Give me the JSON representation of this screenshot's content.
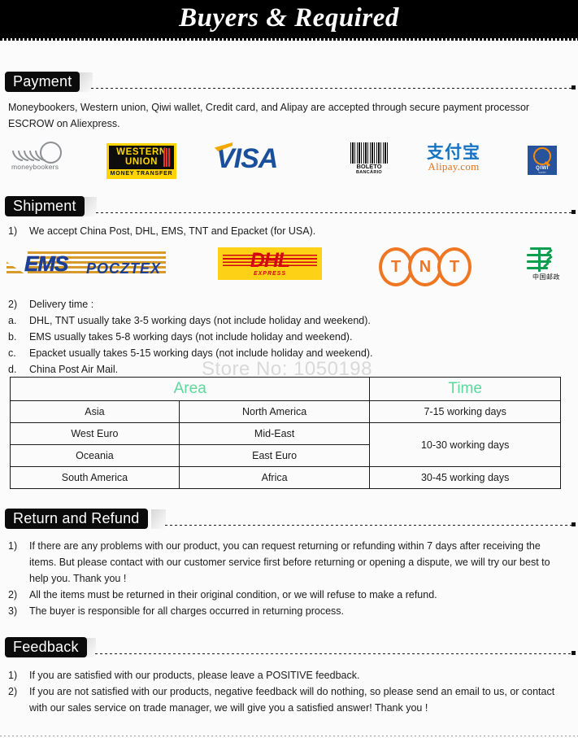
{
  "banner": {
    "title": "Buyers & Required"
  },
  "watermark": "Store No: 1050198",
  "sections": {
    "payment": {
      "tab": "Payment",
      "paragraph": "Moneybookers, Western union, Qiwi wallet, Credit card, and Alipay are accepted through secure payment processor ESCROW on Aliexpress.",
      "logos": [
        {
          "name": "moneybookers-logo",
          "label": "moneybookers"
        },
        {
          "name": "western-union-logo",
          "line1": "WESTERN",
          "line2": "UNION",
          "sub": "MONEY TRANSFER"
        },
        {
          "name": "visa-logo",
          "label": "VISA"
        },
        {
          "name": "boleto-bancario-logo",
          "line1": "BOLETO",
          "line2": "BANCÁRIO"
        },
        {
          "name": "alipay-logo",
          "cn": "支付宝",
          "en": "Alipay.com"
        },
        {
          "name": "qiwi-logo",
          "label": "QIWI",
          "sub": "wallet"
        }
      ]
    },
    "shipment": {
      "tab": "Shipment",
      "item1_num": "1)",
      "item1_text": "We accept China Post, DHL, EMS, TNT and Epacket (for USA).",
      "logos": [
        {
          "name": "ems-pocztex-logo",
          "label": "EMS",
          "sub": "POCZTEX"
        },
        {
          "name": "dhl-logo",
          "label": "DHL",
          "sub": "EXPRESS"
        },
        {
          "name": "tnt-logo",
          "letters": [
            "T",
            "N",
            "T"
          ]
        },
        {
          "name": "china-post-logo",
          "label": "中国邮政"
        }
      ],
      "delivery": [
        {
          "n": "2)",
          "t": "Delivery time :"
        },
        {
          "n": "a.",
          "t": "DHL, TNT usually take 3-5 working days (not include holiday and weekend)."
        },
        {
          "n": "b.",
          "t": "EMS usually takes 5-8 working days (not include holiday and weekend)."
        },
        {
          "n": "c.",
          "t": "Epacket usually takes 5-15 working days (not include holiday and weekend)."
        },
        {
          "n": "d.",
          "t": "China Post Air Mail."
        }
      ],
      "table": {
        "header_area": "Area",
        "header_time": "Time",
        "rows": [
          {
            "col1": "Asia",
            "col2": "North America",
            "time": "7-15 working days",
            "time_rowspan": 1
          },
          {
            "col1": "West Euro",
            "col2": "Mid-East",
            "time": "10-30 working days",
            "time_rowspan": 2
          },
          {
            "col1": "Oceania",
            "col2": "East Euro",
            "time": null,
            "time_rowspan": 0
          },
          {
            "col1": "South America",
            "col2": "Africa",
            "time": "30-45 working days",
            "time_rowspan": 1
          }
        ]
      }
    },
    "return": {
      "tab": "Return and Refund",
      "items": [
        {
          "n": "1)",
          "t": "If there are any problems with our product, you can request returning or refunding within 7 days after receiving the items. But please contact with our customer service first before returning or opening a dispute, we will try our best to  help you. Thank you !"
        },
        {
          "n": "2)",
          "t": "All the items must be returned in their original condition, or we will refuse to make a refund."
        },
        {
          "n": "3)",
          "t": "The buyer is responsible for all charges occurred in returning process."
        }
      ]
    },
    "feedback": {
      "tab": "Feedback",
      "items": [
        {
          "n": "1)",
          "t": "If you are satisfied with our products, please leave a POSITIVE feedback."
        },
        {
          "n": "2)",
          "t": "If you are not satisfied with our products, negative feedback will do nothing, so please send an email to us, or contact with our sales service on trade manager, we will give you a satisfied answer! Thank you !"
        }
      ]
    }
  },
  "colors": {
    "banner_bg": "#000000",
    "page_bg": "#fbfbfc",
    "tab_bg": "#0b0b0b",
    "table_header_green": "#5fd79b",
    "visa_blue": "#1a4f9c",
    "dhl_yellow": "#fcd116",
    "dhl_red": "#d40511",
    "tnt_orange": "#ef7622",
    "china_post_green": "#0f9d4f",
    "qiwi_blue": "#26539c",
    "western_union_yellow": "#ffd400",
    "alipay_blue": "#1673c0",
    "alipay_orange": "#e8700f",
    "ems_blue": "#1c3f94"
  }
}
